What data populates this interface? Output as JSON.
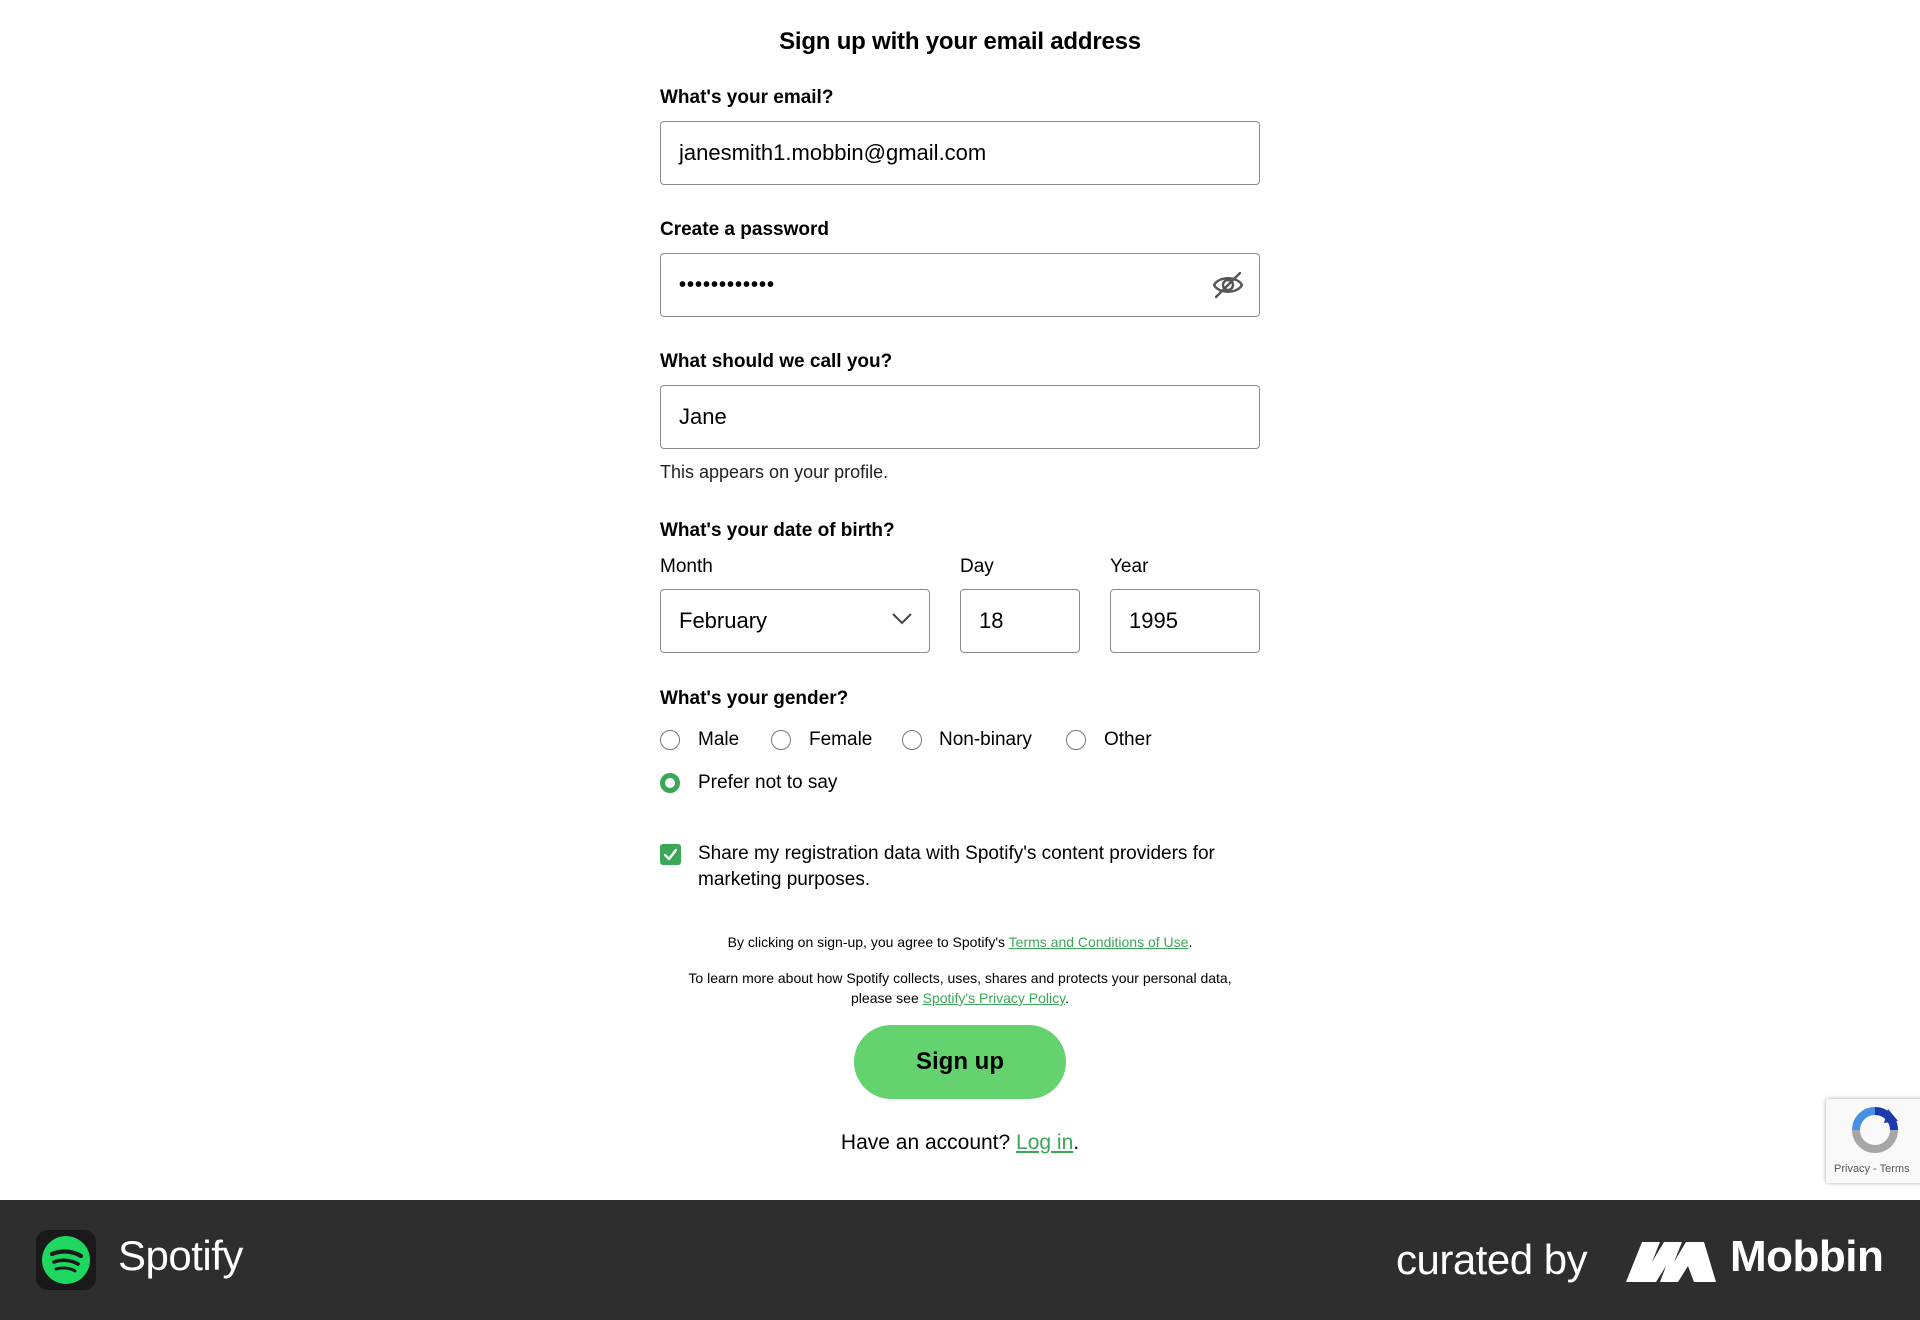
{
  "form": {
    "title": "Sign up with your email address",
    "email": {
      "label": "What's your email?",
      "value": "janesmith1.mobbin@gmail.com"
    },
    "password": {
      "label": "Create a password",
      "value": "••••••••••••",
      "toggle_icon": "eye-slash-icon"
    },
    "name": {
      "label": "What should we call you?",
      "value": "Jane",
      "hint": "This appears on your profile."
    },
    "dob": {
      "label": "What's your date of birth?",
      "month": {
        "label": "Month",
        "value": "February"
      },
      "day": {
        "label": "Day",
        "value": "18"
      },
      "year": {
        "label": "Year",
        "value": "1995"
      }
    },
    "gender": {
      "label": "What's your gender?",
      "options": [
        "Male",
        "Female",
        "Non-binary",
        "Other",
        "Prefer not to say"
      ],
      "selected": "Prefer not to say"
    },
    "share_data": {
      "checked": true,
      "text": "Share my registration data with Spotify's content providers for marketing purposes."
    },
    "legal": {
      "terms_prefix": "By clicking on sign-up, you agree to Spotify's ",
      "terms_link": "Terms and Conditions of Use",
      "terms_suffix": ".",
      "privacy_prefix_1": "To learn more about how Spotify collects, uses, shares and protects your personal data,",
      "privacy_prefix_2": "please see ",
      "privacy_link": "Spotify's Privacy Policy",
      "privacy_suffix": "."
    },
    "signup_button": "Sign up",
    "have_account_text": "Have an account? ",
    "login_link": "Log in",
    "login_suffix": "."
  },
  "recaptcha": {
    "privacy": "Privacy",
    "separator": " - ",
    "terms": "Terms"
  },
  "footer": {
    "app_name": "Spotify",
    "curated_by": "curated by",
    "brand": "Mobbin"
  },
  "colors": {
    "accent_green": "#3aa757",
    "button_green": "#64d26f",
    "footer_bg": "#2e2e2e",
    "spotify_green": "#1ed760"
  }
}
